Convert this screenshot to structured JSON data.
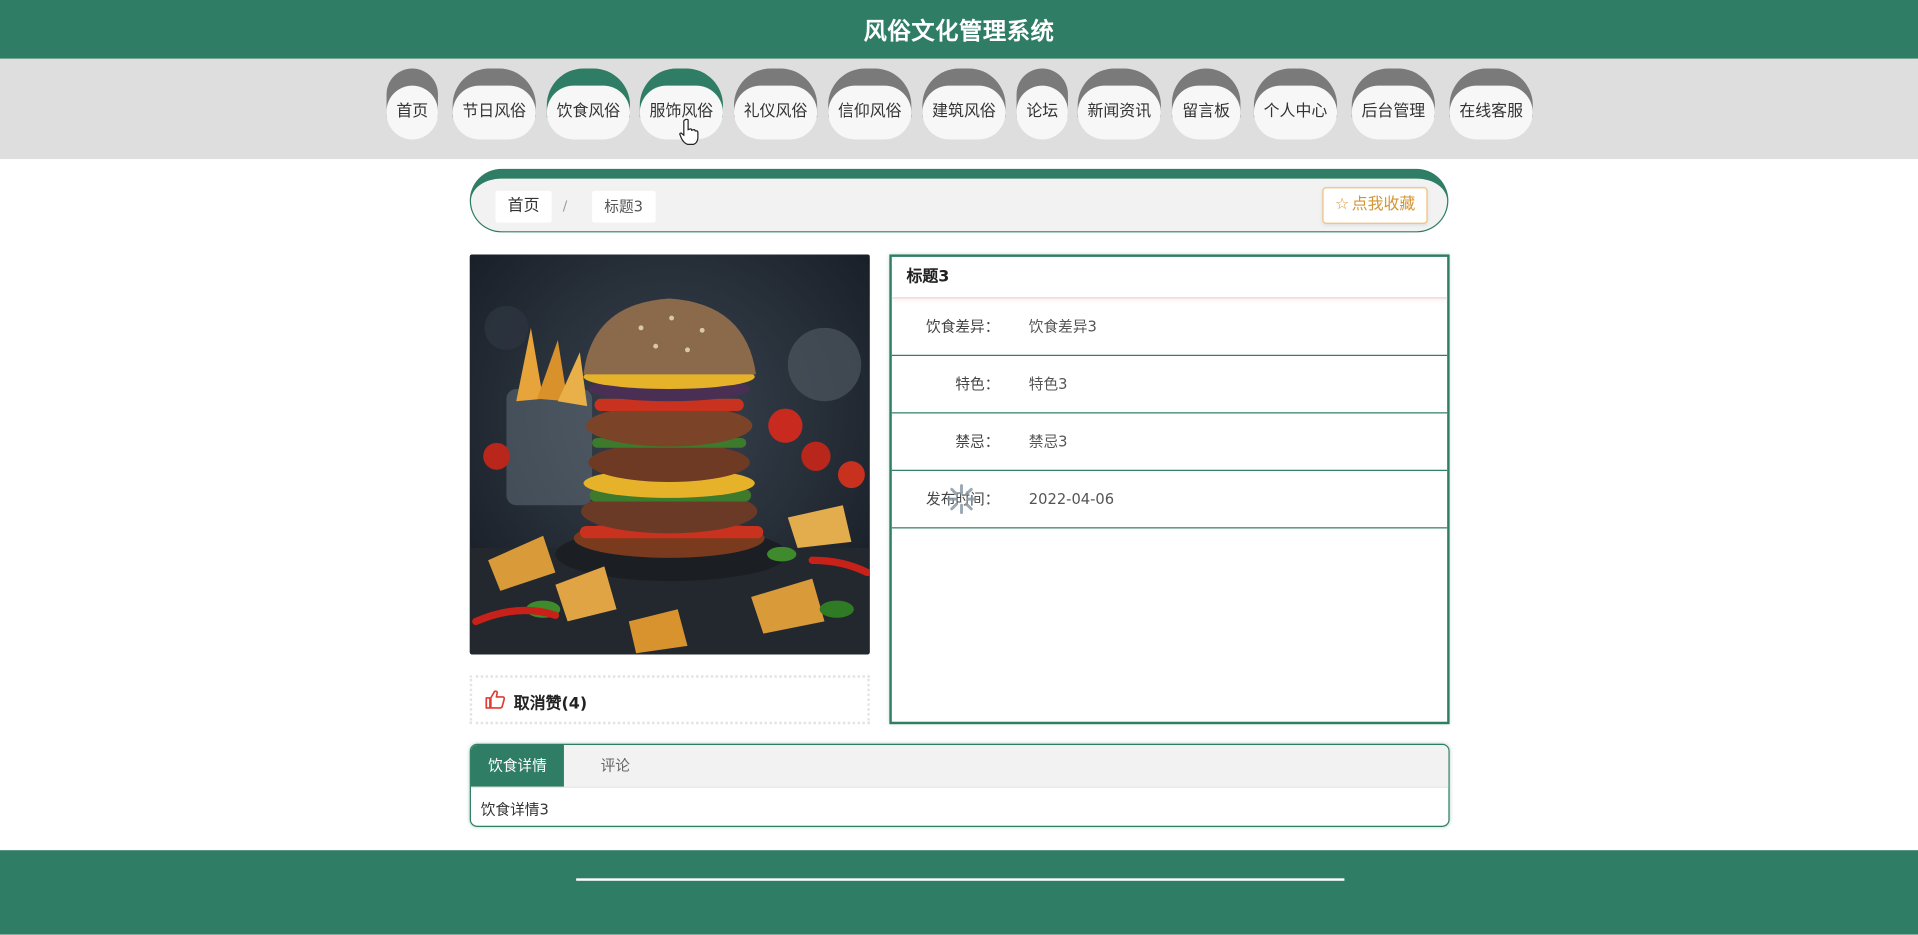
{
  "header": {
    "title": "风俗文化管理系统"
  },
  "nav": {
    "items": [
      {
        "label": "首页"
      },
      {
        "label": "节日风俗"
      },
      {
        "label": "饮食风俗"
      },
      {
        "label": "服饰风俗"
      },
      {
        "label": "礼仪风俗"
      },
      {
        "label": "信仰风俗"
      },
      {
        "label": "建筑风俗"
      },
      {
        "label": "论坛"
      },
      {
        "label": "新闻资讯"
      },
      {
        "label": "留言板"
      },
      {
        "label": "个人中心"
      },
      {
        "label": "后台管理"
      },
      {
        "label": "在线客服"
      }
    ],
    "active": "饮食风俗"
  },
  "breadcrumb": {
    "home": "首页",
    "separator": "/",
    "current": "标题3"
  },
  "favorite_button": {
    "label": "点我收藏"
  },
  "image": {
    "alt": "burger",
    "accent_colors": [
      "#2b3440",
      "#6b3a26",
      "#e6b22a",
      "#c8321f",
      "#3e7a2c",
      "#d99a3a"
    ]
  },
  "like": {
    "label": "取消赞(4)"
  },
  "info": {
    "title": "标题3",
    "fields": [
      {
        "label": "饮食差异：",
        "value": "饮食差异3"
      },
      {
        "label": "特色：",
        "value": "特色3"
      },
      {
        "label": "禁忌：",
        "value": "禁忌3"
      },
      {
        "label": "发布时间：",
        "value": "2022-04-06"
      }
    ]
  },
  "tabs": {
    "items": [
      {
        "label": "饮食详情"
      },
      {
        "label": "评论"
      }
    ],
    "content": "饮食详情3"
  },
  "colors": {
    "primary": "#2f7d64",
    "nav_bg": "#dedede",
    "cap_gray": "#7a7a7a",
    "favorite": "#d49635",
    "like_icon": "#e03c31"
  }
}
